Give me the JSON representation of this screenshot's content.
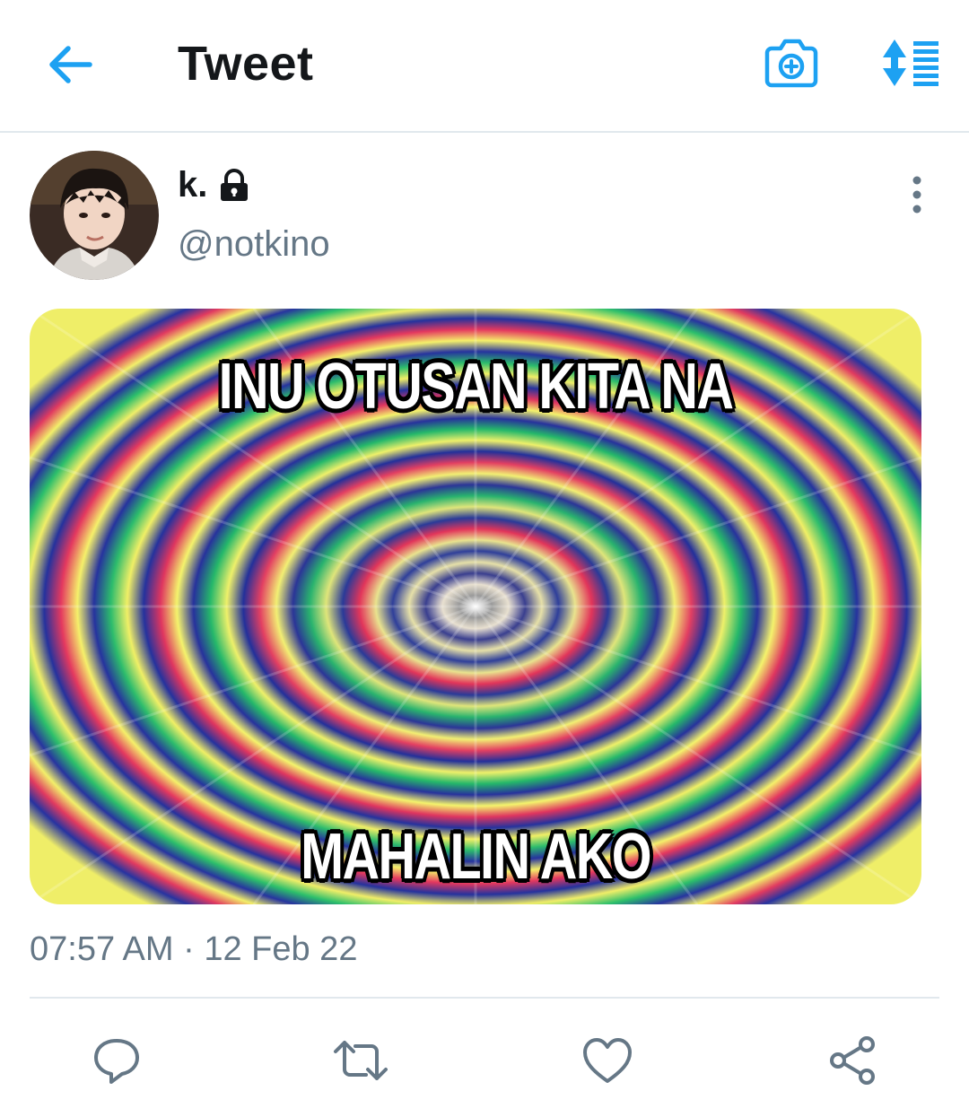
{
  "header": {
    "title": "Tweet",
    "back_icon": "arrow-left-icon",
    "camera_icon": "camera-plus-icon",
    "sort_icon": "sort-list-icon",
    "accent_color": "#1da1f2"
  },
  "tweet": {
    "author": {
      "display_name": "k.",
      "protected_icon": "lock-icon",
      "handle": "@notkino"
    },
    "media": {
      "top_caption": "INU OTUSAN KITA NA",
      "bottom_caption": "MAHALIN AKO"
    },
    "timestamp": "07:57 AM · 12 Feb 22",
    "more_icon": "more-vertical-icon"
  },
  "actions": [
    {
      "name": "reply",
      "icon": "reply-icon"
    },
    {
      "name": "retweet",
      "icon": "retweet-icon"
    },
    {
      "name": "like",
      "icon": "heart-icon"
    },
    {
      "name": "share",
      "icon": "share-icon"
    }
  ],
  "colors": {
    "text_primary": "#14171a",
    "text_secondary": "#657786",
    "divider": "#e1e8ed",
    "icon_gray": "#657786"
  }
}
